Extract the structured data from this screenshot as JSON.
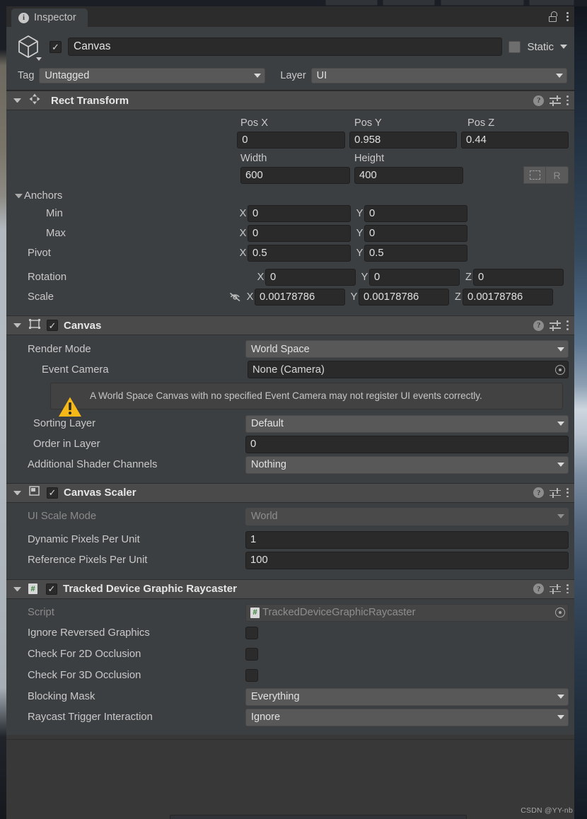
{
  "window": {
    "tab_label": "Inspector",
    "tab_icon": "info-icon",
    "lock_icon": "lock-open-icon",
    "menu_icon": "kebab-menu-icon"
  },
  "object_header": {
    "icon": "gameobject-cube-icon",
    "enabled_checkbox": "✓",
    "name": "Canvas",
    "static_label": "Static",
    "static_dropdown_icon": "chevron-down-icon",
    "tag_label": "Tag",
    "tag_value": "Untagged",
    "layer_label": "Layer",
    "layer_value": "UI"
  },
  "components": [
    {
      "title": "Rect Transform",
      "icon": "rect-transform-icon",
      "has_checkbox": false,
      "help_icon": "help-icon",
      "preset_icon": "preset-settings-icon",
      "menu_icon": "kebab-menu-icon"
    },
    {
      "title": "Canvas",
      "icon": "canvas-icon",
      "has_checkbox": true,
      "enabled": "✓"
    },
    {
      "title": "Canvas Scaler",
      "icon": "canvas-scaler-icon",
      "has_checkbox": true,
      "enabled": "✓"
    },
    {
      "title": "Tracked Device Graphic Raycaster",
      "icon": "script-icon",
      "has_checkbox": true,
      "enabled": "✓"
    }
  ],
  "rect_transform": {
    "pos_x_label": "Pos X",
    "pos_y_label": "Pos Y",
    "pos_z_label": "Pos Z",
    "pos_x": "0",
    "pos_y": "0.958",
    "pos_z": "0.44",
    "width_label": "Width",
    "height_label": "Height",
    "width": "600",
    "height": "400",
    "blueprint_button": "blueprint-mode-icon",
    "raw_button": "R",
    "anchors_label": "Anchors",
    "min_label": "Min",
    "max_label": "Max",
    "pivot_label": "Pivot",
    "min_x": "0",
    "min_y": "0",
    "max_x": "0",
    "max_y": "0",
    "pivot_x": "0.5",
    "pivot_y": "0.5",
    "rotation_label": "Rotation",
    "rotation_x": "0",
    "rotation_y": "0",
    "rotation_z": "0",
    "scale_label": "Scale",
    "scale_link_icon": "link-off-icon",
    "scale_x": "0.00178786",
    "scale_y": "0.00178786",
    "scale_z": "0.00178786",
    "axis_x": "X",
    "axis_y": "Y",
    "axis_z": "Z"
  },
  "canvas": {
    "render_mode_label": "Render Mode",
    "render_mode_value": "World Space",
    "event_camera_label": "Event Camera",
    "event_camera_value": "None (Camera)",
    "warning_icon": "warning-triangle-icon",
    "warning_text": "A World Space Canvas with no specified Event Camera may not register UI events correctly.",
    "sorting_layer_label": "Sorting Layer",
    "sorting_layer_value": "Default",
    "order_in_layer_label": "Order in Layer",
    "order_in_layer_value": "0",
    "additional_shader_channels_label": "Additional Shader Channels",
    "additional_shader_channels_value": "Nothing"
  },
  "canvas_scaler": {
    "ui_scale_mode_label": "UI Scale Mode",
    "ui_scale_mode_value": "World",
    "dynamic_pixels_label": "Dynamic Pixels Per Unit",
    "dynamic_pixels_value": "1",
    "reference_pixels_label": "Reference Pixels Per Unit",
    "reference_pixels_value": "100"
  },
  "raycaster": {
    "script_label": "Script",
    "script_value": "TrackedDeviceGraphicRaycaster",
    "ignore_reversed_label": "Ignore Reversed Graphics",
    "ignore_reversed_checked": false,
    "check_2d_label": "Check For 2D Occlusion",
    "check_2d_checked": false,
    "check_3d_label": "Check For 3D Occlusion",
    "check_3d_checked": false,
    "blocking_mask_label": "Blocking Mask",
    "blocking_mask_value": "Everything",
    "raycast_trigger_label": "Raycast Trigger Interaction",
    "raycast_trigger_value": "Ignore"
  },
  "watermark": "CSDN @YY-nb",
  "colors": {
    "panel_bg": "#3c3f41",
    "component_header": "#4a4a4a",
    "field_bg": "#2a2a2a",
    "dropdown_bg": "#585858",
    "text": "#c9c9c9",
    "warning_yellow": "#f5b816",
    "script_green": "#2f7d32"
  }
}
